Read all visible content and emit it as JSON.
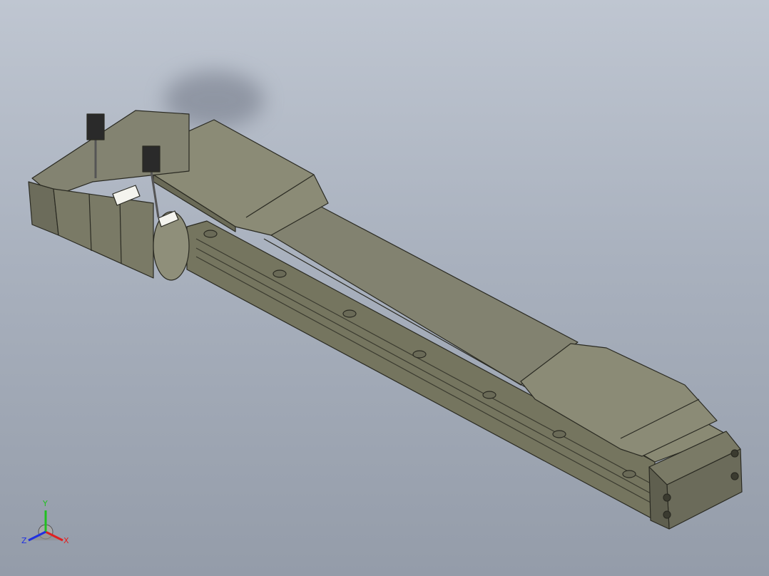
{
  "viewport": {
    "background_top": "#bfc6d1",
    "background_bottom": "#949ca9",
    "model_body_color": "#7f7f6a",
    "model_edge_color": "#2a2a22"
  },
  "triad": {
    "x_label": "X",
    "y_label": "Y",
    "z_label": "Z",
    "x_color": "#e02020",
    "y_color": "#20c020",
    "z_color": "#2030e0"
  }
}
